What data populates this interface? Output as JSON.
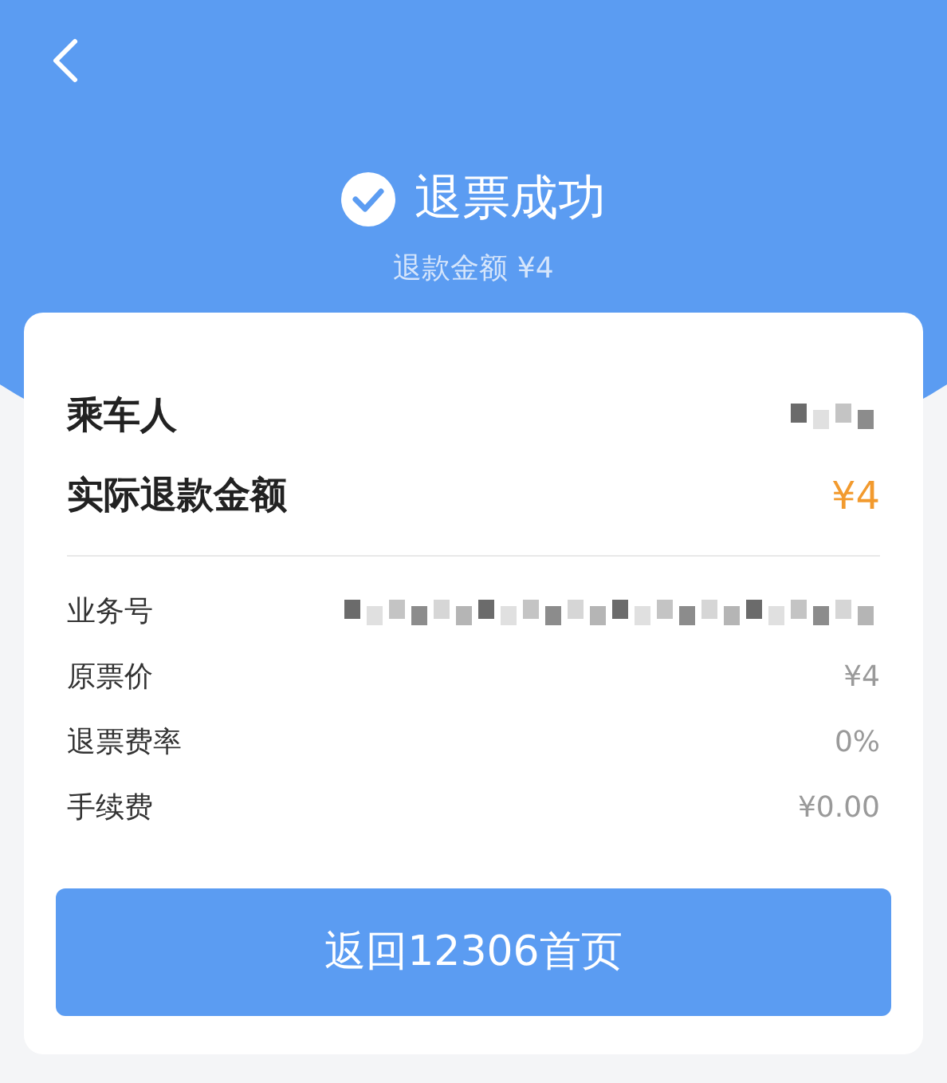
{
  "header": {
    "title": "退票成功",
    "subtitle": "退款金额 ¥4"
  },
  "summary": [
    {
      "label": "乘车人",
      "kind": "masked"
    },
    {
      "label": "实际退款金额",
      "kind": "amount",
      "value": "¥4"
    }
  ],
  "details": [
    {
      "label": "业务号",
      "kind": "masked"
    },
    {
      "label": "原票价",
      "kind": "text",
      "value": "¥4"
    },
    {
      "label": "退票费率",
      "kind": "text",
      "value": "0%"
    },
    {
      "label": "手续费",
      "kind": "text",
      "value": "¥0.00"
    }
  ],
  "button": {
    "label": "返回12306首页"
  }
}
